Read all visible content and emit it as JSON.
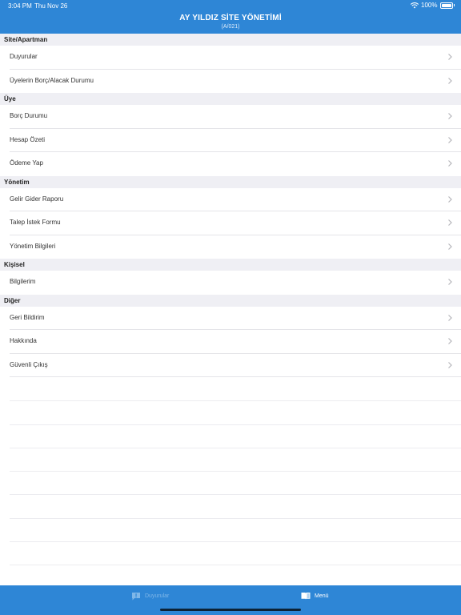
{
  "status_bar": {
    "time": "3:04 PM",
    "date": "Thu Nov 26",
    "battery": "100%"
  },
  "header": {
    "title": "AY YILDIZ SİTE YÖNETİMİ",
    "subtitle": "(A/021)"
  },
  "sections": [
    {
      "title": "Site/Apartman",
      "items": [
        "Duyurular",
        "Üyelerin Borç/Alacak Durumu"
      ]
    },
    {
      "title": "Üye",
      "items": [
        "Borç Durumu",
        "Hesap Özeti",
        "Ödeme Yap"
      ]
    },
    {
      "title": "Yönetim",
      "items": [
        "Gelir Gider Raporu",
        "Talep İstek Formu",
        "Yönetim Bilgileri"
      ]
    },
    {
      "title": "Kişisel",
      "items": [
        "Bilgilerim"
      ]
    },
    {
      "title": "Diğer",
      "items": [
        "Geri Bildirim",
        "Hakkında",
        "Güvenli Çıkış"
      ]
    }
  ],
  "tabbar": {
    "announcements": "Duyurular",
    "menu": "Menü"
  },
  "colors": {
    "brand": "#2e86d6",
    "section_bg": "#efeff4",
    "inactive_tab": "#7fb7e8"
  }
}
